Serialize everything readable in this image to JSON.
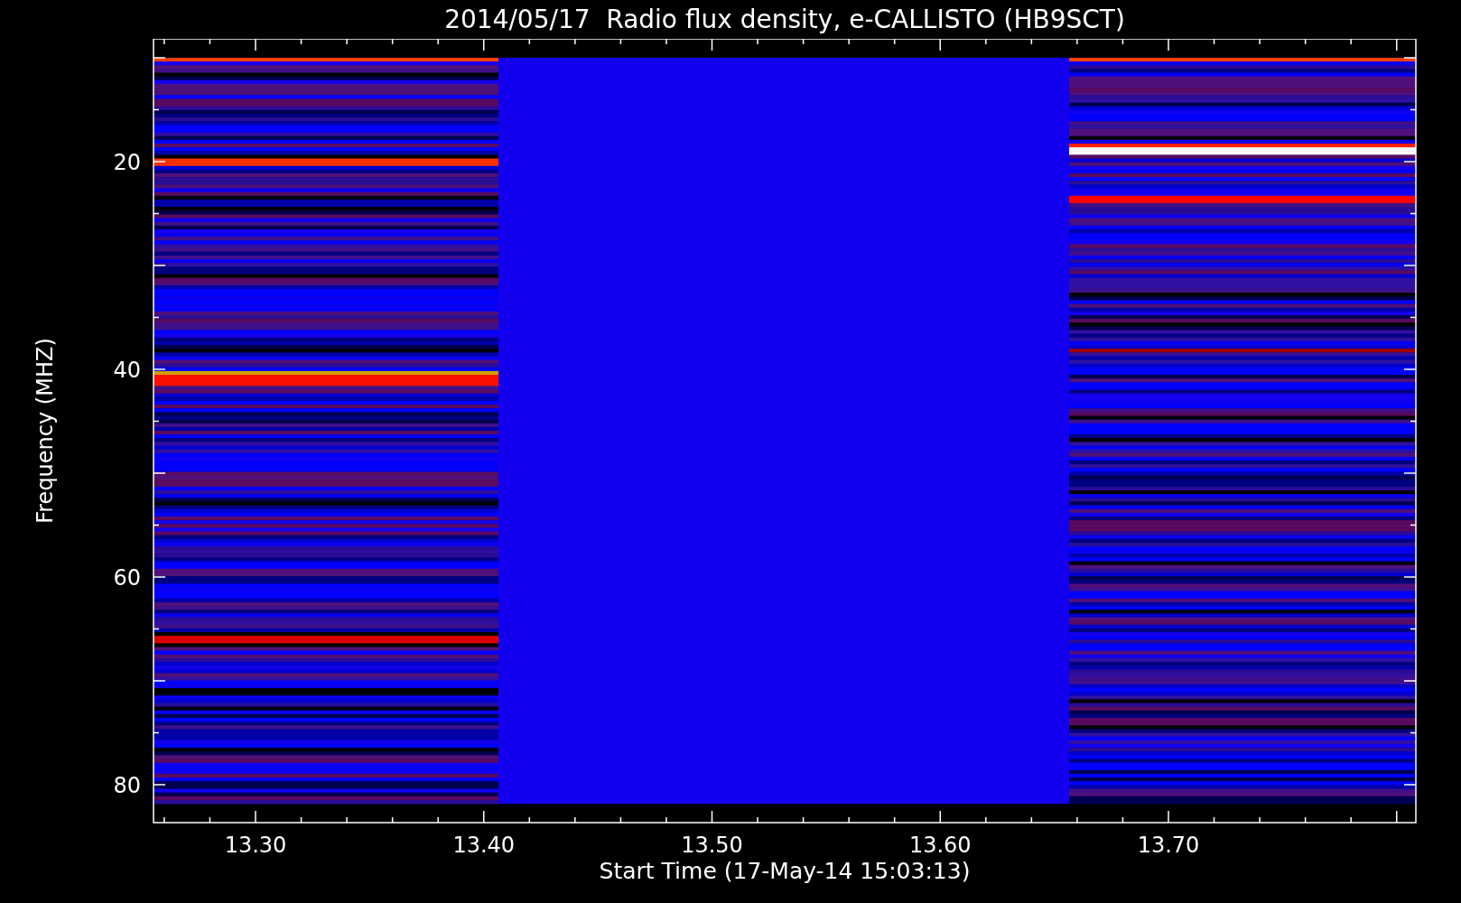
{
  "title": "2014/05/17  Radio flux density, e-CALLISTO (HB9SCT)",
  "y_axis": {
    "label": "Frequency (MHZ)",
    "ticks": [
      "20",
      "40",
      "60",
      "80"
    ]
  },
  "x_axis": {
    "label": "Start Time (17-May-14 15:03:13)",
    "ticks": [
      "13.30",
      "13.40",
      "13.50",
      "13.60",
      "13.70"
    ]
  }
}
